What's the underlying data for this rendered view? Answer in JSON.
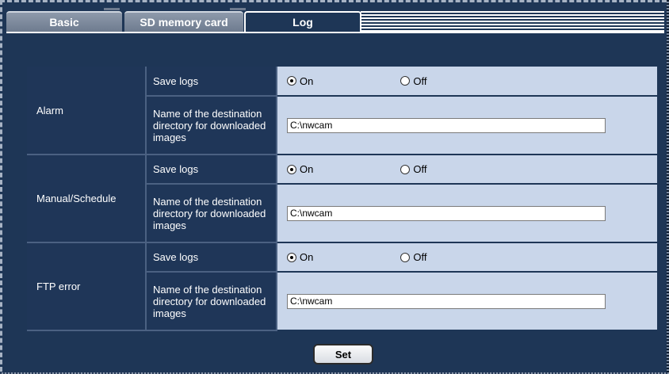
{
  "tabs": [
    {
      "label": "Basic"
    },
    {
      "label": "SD memory card"
    },
    {
      "label": "Log"
    }
  ],
  "sections": [
    {
      "group": "Alarm",
      "save_logs_label": "Save logs",
      "on_label": "On",
      "off_label": "Off",
      "save_logs_value": "On",
      "dir_label": "Name of the destination directory for downloaded images",
      "dir_value": "C:\\nwcam"
    },
    {
      "group": "Manual/Schedule",
      "save_logs_label": "Save logs",
      "on_label": "On",
      "off_label": "Off",
      "save_logs_value": "On",
      "dir_label": "Name of the destination directory for downloaded images",
      "dir_value": "C:\\nwcam"
    },
    {
      "group": "FTP error",
      "save_logs_label": "Save logs",
      "on_label": "On",
      "off_label": "Off",
      "save_logs_value": "On",
      "dir_label": "Name of the destination directory for downloaded images",
      "dir_value": "C:\\nwcam"
    }
  ],
  "set_button": "Set",
  "colors": {
    "background": "#1e3656",
    "value_cell": "#c9d6ea",
    "label_cell": "#1f3658"
  }
}
